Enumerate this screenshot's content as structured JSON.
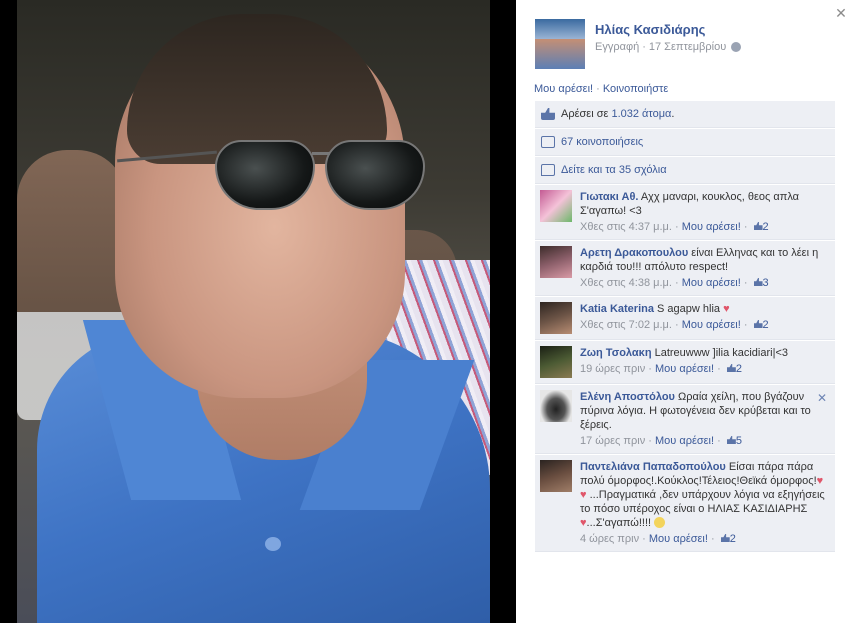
{
  "post": {
    "owner_name": "Ηλίας Κασιδιάρης",
    "post_type": "Εγγραφή",
    "separator": "·",
    "date": "17 Σεπτεμβρίου",
    "close_glyph": "✕",
    "privacy_icon": "globe-icon"
  },
  "actions": {
    "like": "Μου αρέσει!",
    "dot": " · ",
    "share": "Κοινοποιήστε"
  },
  "summary": {
    "likes_prefix": "Αρέσει σε ",
    "likes_link": "1.032 άτομα",
    "likes_suffix": ".",
    "shares": "67 κοινοποιήσεις",
    "comments_link": "Δείτε και τα 35 σχόλια"
  },
  "comments": [
    {
      "name": "Γιωτακι Αθ.",
      "text": " Αχχ μαναρι, κουκλος, θεος απλα Σ'αγαπω! <3",
      "time": "Χθες στις 4:37 μ.μ.",
      "like_label": "Μου αρέσει!",
      "likes": "2",
      "avatar_color": "#b04a7e"
    },
    {
      "name": "Αρετη Δρακοπουλου",
      "text": " είναι Ελληνας και το λέει η καρδιά του!!! απόλυτο respect!",
      "time": "Χθες στις 4:38 μ.μ.",
      "like_label": "Μου αρέσει!",
      "likes": "3",
      "avatar_color": "#7a4f5c"
    },
    {
      "name": "Katia Katerina",
      "text": " S agapw hlia",
      "time": "Χθες στις 7:02 μ.μ.",
      "like_label": "Μου αρέσει!",
      "likes": "2",
      "avatar_color": "#5a4a42"
    },
    {
      "name": "Ζωη Τσολακη",
      "text": " Latreuwww ]ilia kacidiari|<3",
      "time": "19 ώρες πριν",
      "like_label": "Μου αρέσει!",
      "likes": "2",
      "avatar_color": "#2f3a24"
    },
    {
      "name": "Ελένη Αποστόλου",
      "text": " Ωραία χείλη, που βγάζουν πύρινα λόγια. Η φωτογένεια δεν κρύβεται και το ξέρεις.",
      "time": "17 ώρες πριν",
      "like_label": "Μου αρέσει!",
      "likes": "5",
      "avatar_color": "#d7d7d7",
      "close_glyph": "✕"
    },
    {
      "name": "Παντελιάνα Παπαδοπούλου",
      "text_a": " Είσαι πάρα πάρα πολύ όμορφος!.Κούκλος!Τέλειος!Θεϊκά όμορφος!",
      "text_b": "...Πραγματικά ,δεν υπάρχουν λόγια να εξηγήσεις το πόσο υπέροχος είναι ο ΗΛΙΑΣ ΚΑΣΙΔΙΑΡΗΣ",
      "text_c": "...Σ'αγαπώ!!!!",
      "heart": "♥",
      "time": "4 ώρες πριν",
      "like_label": "Μου αρέσει!",
      "likes": "2",
      "avatar_color": "#3b3430"
    }
  ],
  "sep": " · "
}
